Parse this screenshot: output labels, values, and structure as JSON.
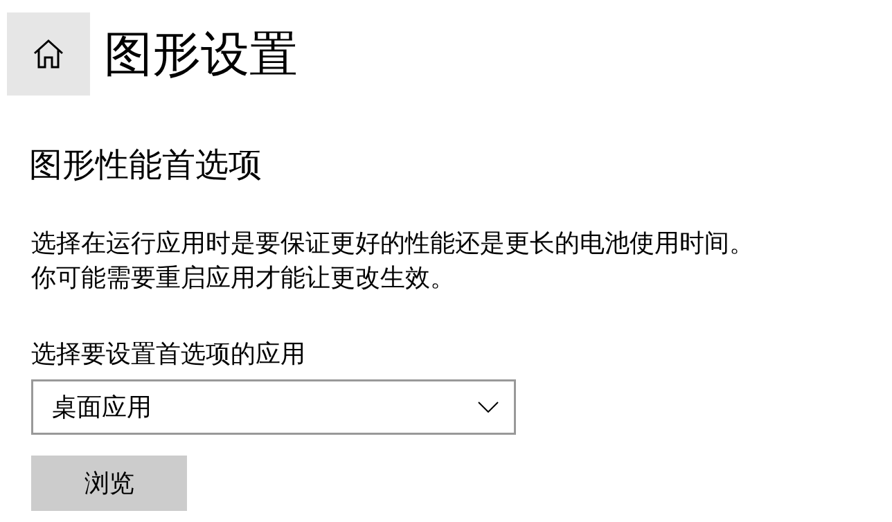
{
  "header": {
    "title": "图形设置"
  },
  "section": {
    "heading": "图形性能首选项",
    "description": [
      "选择在运行应用时是要保证更好的性能还是更长的电池使用时间。",
      "你可能需要重启应用才能让更改生效。"
    ]
  },
  "app_picker": {
    "label": "选择要设置首选项的应用",
    "value": "桌面应用",
    "button": "浏览"
  }
}
